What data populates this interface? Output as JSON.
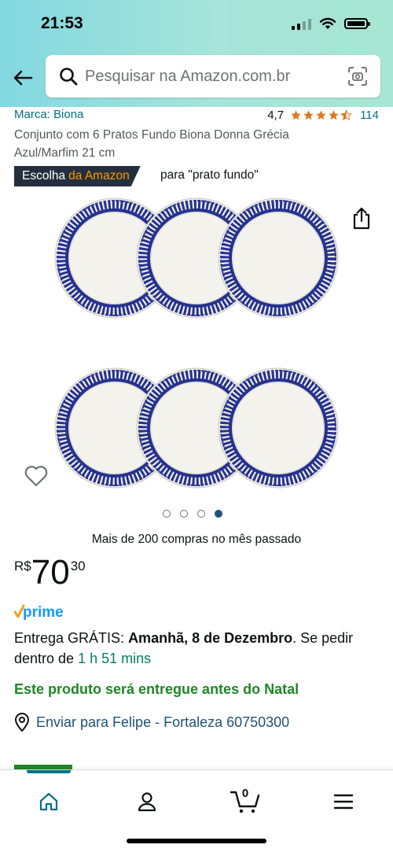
{
  "status_bar": {
    "time": "21:53"
  },
  "search": {
    "placeholder": "Pesquisar na Amazon.com.br"
  },
  "product": {
    "brand": "Marca: Biona",
    "rating_value": "4,7",
    "rating_stars": 4.5,
    "rating_count": "114",
    "title": "Conjunto com 6 Pratos Fundo Biona Donna Grécia Azul/Marfim 21 cm",
    "choice_badge": {
      "part1": "Escolha",
      "part2": "da Amazon"
    },
    "choice_for": "para \"prato fundo\"",
    "carousel": {
      "total": 4,
      "active_index": 4
    },
    "purchases": "Mais de 200 compras no mês passado",
    "price": {
      "currency": "R$",
      "whole": "70",
      "cents": "30"
    },
    "prime_label": "prime",
    "delivery": {
      "prefix": "Entrega GRÁTIS: ",
      "date": "Amanhã, 8 de Dezembro",
      "suffix": ". Se pedir dentro de ",
      "countdown": "1 h 51 mins"
    },
    "christmas_note": "Este produto será entregue antes do Natal",
    "location": "Enviar para Felipe - Fortaleza 60750300"
  },
  "bottom_nav": {
    "cart_count": "0",
    "active_tab": "home"
  },
  "colors": {
    "link": "#007185",
    "location": "#1e5273",
    "green": "#067d62",
    "christmas": "#1f8727",
    "prime_check": "#f7a21b",
    "prime_blue": "#1399ff",
    "badge_bg": "#232f3e",
    "badge_orange": "#ff9900",
    "star": "#de7921",
    "plate_blue": "#26328f",
    "plate_cream": "#efeee6"
  }
}
